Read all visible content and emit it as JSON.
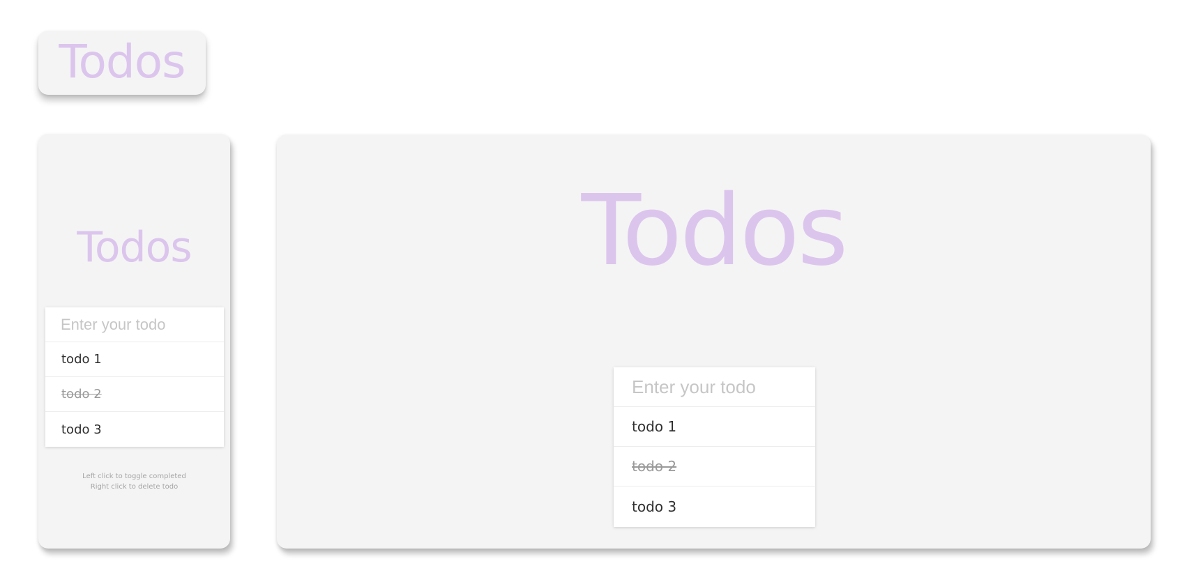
{
  "logo": {
    "title": "Todos"
  },
  "mobile": {
    "title": "Todos",
    "input": {
      "placeholder": "Enter your todo",
      "value": ""
    },
    "todos": [
      {
        "text": "todo 1",
        "completed": false
      },
      {
        "text": "todo 2",
        "completed": true
      },
      {
        "text": "todo 3",
        "completed": false
      }
    ],
    "hints": {
      "toggle": "Left click to toggle completed",
      "delete": "Right click to delete todo"
    }
  },
  "desktop": {
    "title": "Todos",
    "input": {
      "placeholder": "Enter your todo",
      "value": ""
    },
    "todos": [
      {
        "text": "todo 1",
        "completed": false
      },
      {
        "text": "todo 2",
        "completed": true
      },
      {
        "text": "todo 3",
        "completed": false
      }
    ]
  },
  "colors": {
    "accent": "#dcc5ed",
    "card": "#f4f4f4",
    "text": "#2f2f2f",
    "completed_text": "#9a9a9a",
    "placeholder": "#c6c6c6"
  }
}
